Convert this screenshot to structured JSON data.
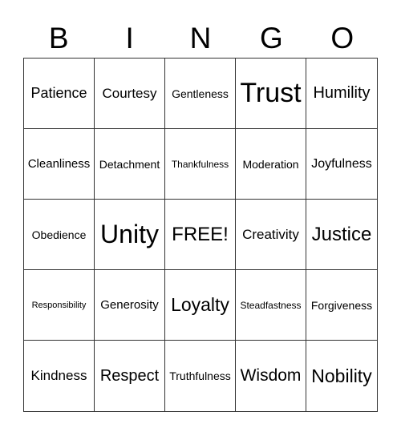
{
  "header": [
    "B",
    "I",
    "N",
    "G",
    "O"
  ],
  "cells": [
    "Patience",
    "Courtesy",
    "Gentleness",
    "Trust",
    "Humility",
    "Cleanliness",
    "Detachment",
    "Thankfulness",
    "Moderation",
    "Joyfulness",
    "Obedience",
    "Unity",
    "FREE!",
    "Creativity",
    "Justice",
    "Responsibility",
    "Generosity",
    "Loyalty",
    "Steadfastness",
    "Forgiveness",
    "Kindness",
    "Respect",
    "Truthfulness",
    "Wisdom",
    "Nobility"
  ]
}
